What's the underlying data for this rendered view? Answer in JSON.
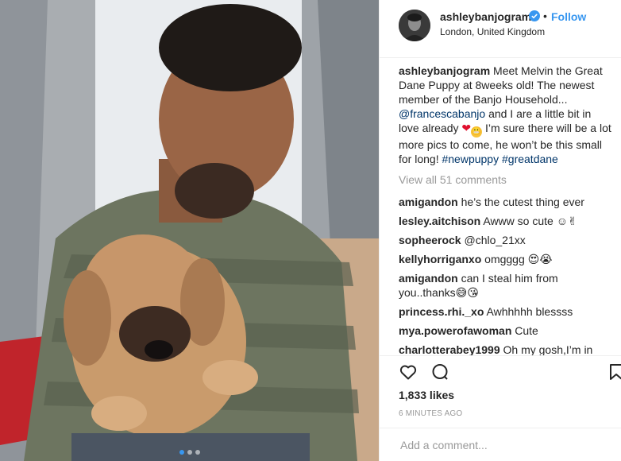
{
  "photo": {
    "alt_icon": "photo",
    "carousel": {
      "count": 3,
      "active_index": 0
    }
  },
  "header": {
    "username": "ashleybanjogram",
    "separator": "•",
    "follow_label": "Follow",
    "location": "London, United Kingdom"
  },
  "caption": {
    "username": "ashleybanjogram",
    "text_1": "Meet Melvin the Great Dane Puppy at 8weeks old! The newest member of the Banjo Household...",
    "mention": "@francescabanjo",
    "text_2": "and I are a little bit in love already",
    "text_3": "I’m sure there will be a lot more pics to come, he won’t be this small for long!",
    "hashtag_1": "#newpuppy",
    "hashtag_2": "#greatdane"
  },
  "view_all_comments": "View all 51 comments",
  "comments": [
    {
      "username": "amigandon",
      "text": "he’s the cutest thing ever"
    },
    {
      "username": "lesley.aitchison",
      "text": "Awww so cute ☺✌"
    },
    {
      "username": "sopheerock",
      "text": "@chlo_21xx"
    },
    {
      "username": "kellyhorriganxo",
      "text": "omgggg 😍😭"
    },
    {
      "username": "amigandon",
      "text": "can I steal him from you..thanks😅😘"
    },
    {
      "username": "princess.rhi._xo",
      "text": "Awhhhhh blessss"
    },
    {
      "username": "mya.powerofawoman",
      "text": "Cute"
    },
    {
      "username": "charlotterabey1999",
      "text": "Oh my gosh,I’m in love"
    }
  ],
  "likes": "1,833 likes",
  "timestamp": "6 MINUTES AGO",
  "add_comment": {
    "placeholder": "Add a comment..."
  },
  "colors": {
    "accent": "#3897f0",
    "muted": "#999999",
    "text": "#262626",
    "link": "#003569"
  }
}
